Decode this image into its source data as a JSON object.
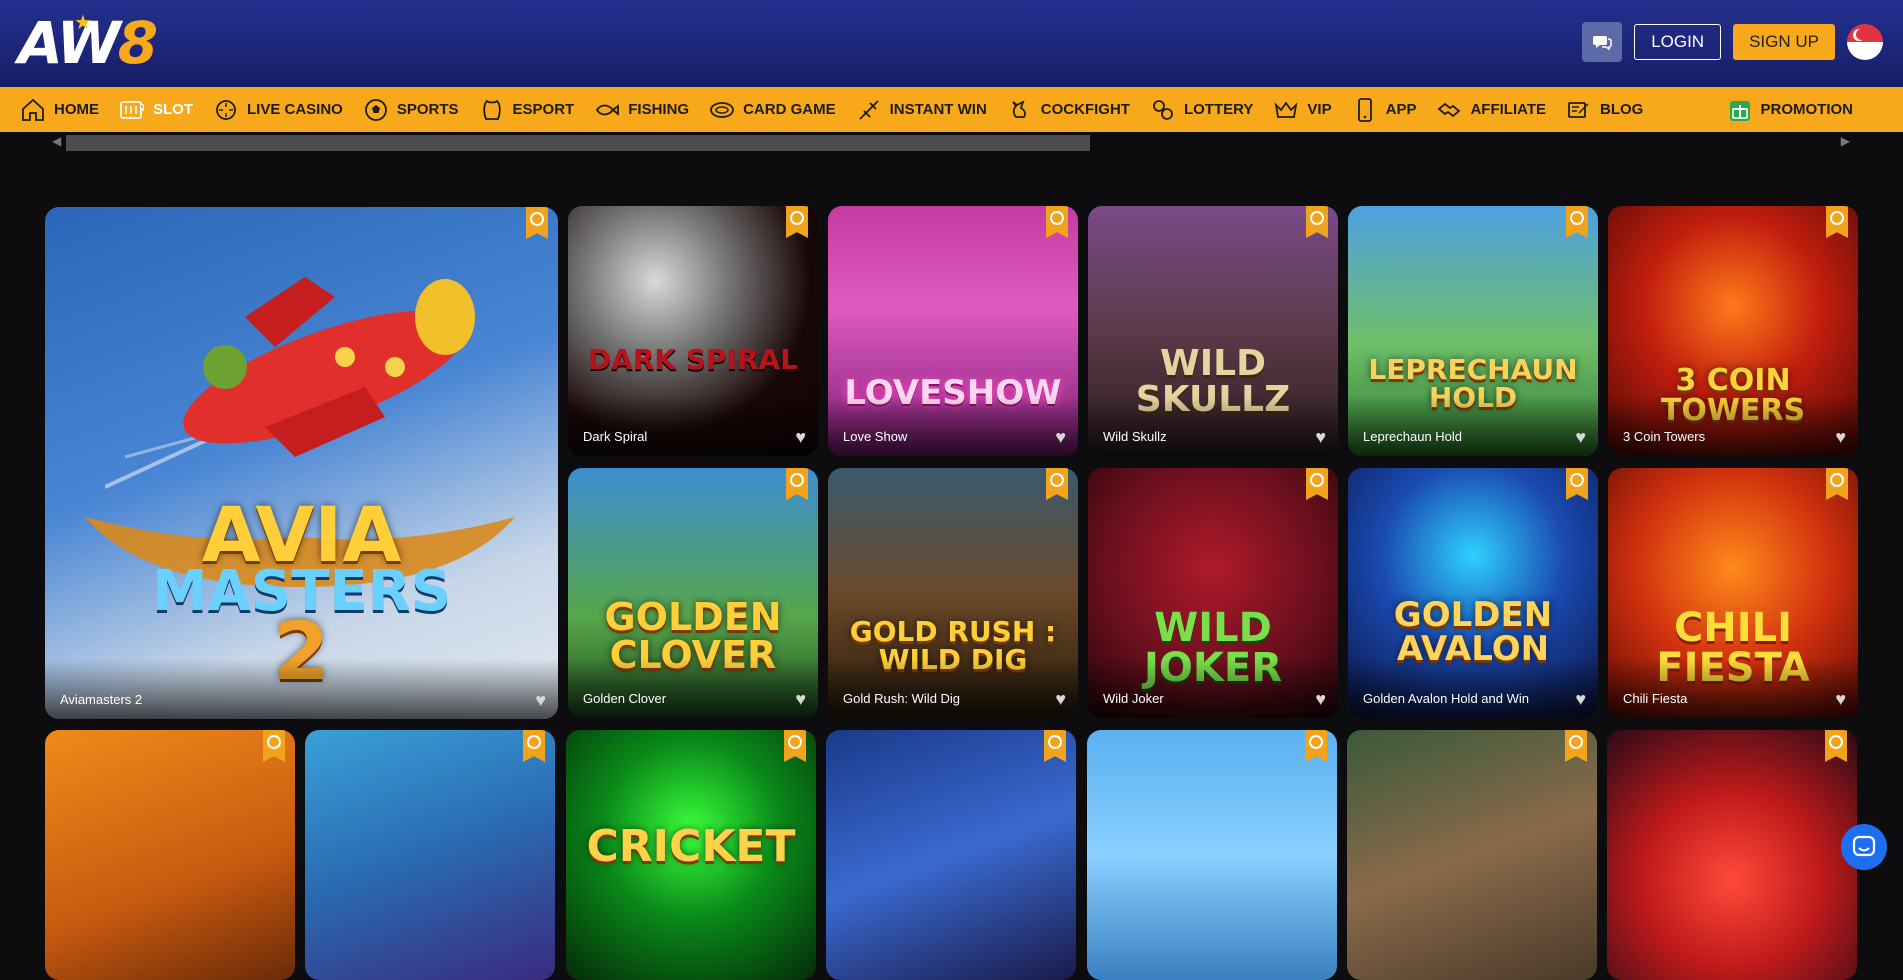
{
  "brand": {
    "logo_main": "AW",
    "logo_accent": "8"
  },
  "header": {
    "login_label": "LOGIN",
    "signup_label": "SIGN UP"
  },
  "nav": {
    "items": [
      {
        "label": "HOME",
        "icon": "home-icon"
      },
      {
        "label": "SLOT",
        "icon": "slot-icon",
        "active": true
      },
      {
        "label": "LIVE CASINO",
        "icon": "live-casino-icon"
      },
      {
        "label": "SPORTS",
        "icon": "sports-icon"
      },
      {
        "label": "ESPORT",
        "icon": "esport-icon"
      },
      {
        "label": "FISHING",
        "icon": "fishing-icon"
      },
      {
        "label": "CARD GAME",
        "icon": "card-game-icon"
      },
      {
        "label": "INSTANT WIN",
        "icon": "instant-win-icon"
      },
      {
        "label": "COCKFIGHT",
        "icon": "cockfight-icon"
      },
      {
        "label": "LOTTERY",
        "icon": "lottery-icon"
      },
      {
        "label": "VIP",
        "icon": "vip-icon"
      },
      {
        "label": "APP",
        "icon": "app-icon"
      },
      {
        "label": "AFFILIATE",
        "icon": "affiliate-icon"
      },
      {
        "label": "BLOG",
        "icon": "blog-icon"
      }
    ],
    "promotion_label": "PROMOTION"
  },
  "games": {
    "featured": {
      "name": "Aviamasters 2",
      "art_line1": "AVIA",
      "art_line2": "MASTERS",
      "art_line3": "2"
    },
    "row1": [
      {
        "name": "Dark Spiral",
        "art": "DARK SPIRAL"
      },
      {
        "name": "Love Show",
        "art": "LOVESHOW"
      },
      {
        "name": "Wild Skullz",
        "art": "WILD SKULLZ"
      },
      {
        "name": "Leprechaun Hold",
        "art": "LEPRECHAUN HOLD"
      },
      {
        "name": "3 Coin Towers",
        "art": "3 COIN TOWERS"
      }
    ],
    "row2": [
      {
        "name": "Golden Clover",
        "art": "GOLDEN CLOVER"
      },
      {
        "name": "Gold Rush: Wild Dig",
        "art": "GOLD RUSH : WILD DIG"
      },
      {
        "name": "Wild Joker",
        "art": "WILD JOKER"
      },
      {
        "name": "Golden Avalon Hold and Win",
        "art": "GOLDEN AVALON"
      },
      {
        "name": "Chili Fiesta",
        "art": "CHILI FIESTA"
      }
    ],
    "row3_art": [
      "",
      "",
      "CRICKET",
      "",
      "",
      "",
      ""
    ]
  },
  "colors": {
    "accent": "#f7a81b",
    "header_bg": "#1c2578",
    "page_bg": "#0d0d0f"
  }
}
